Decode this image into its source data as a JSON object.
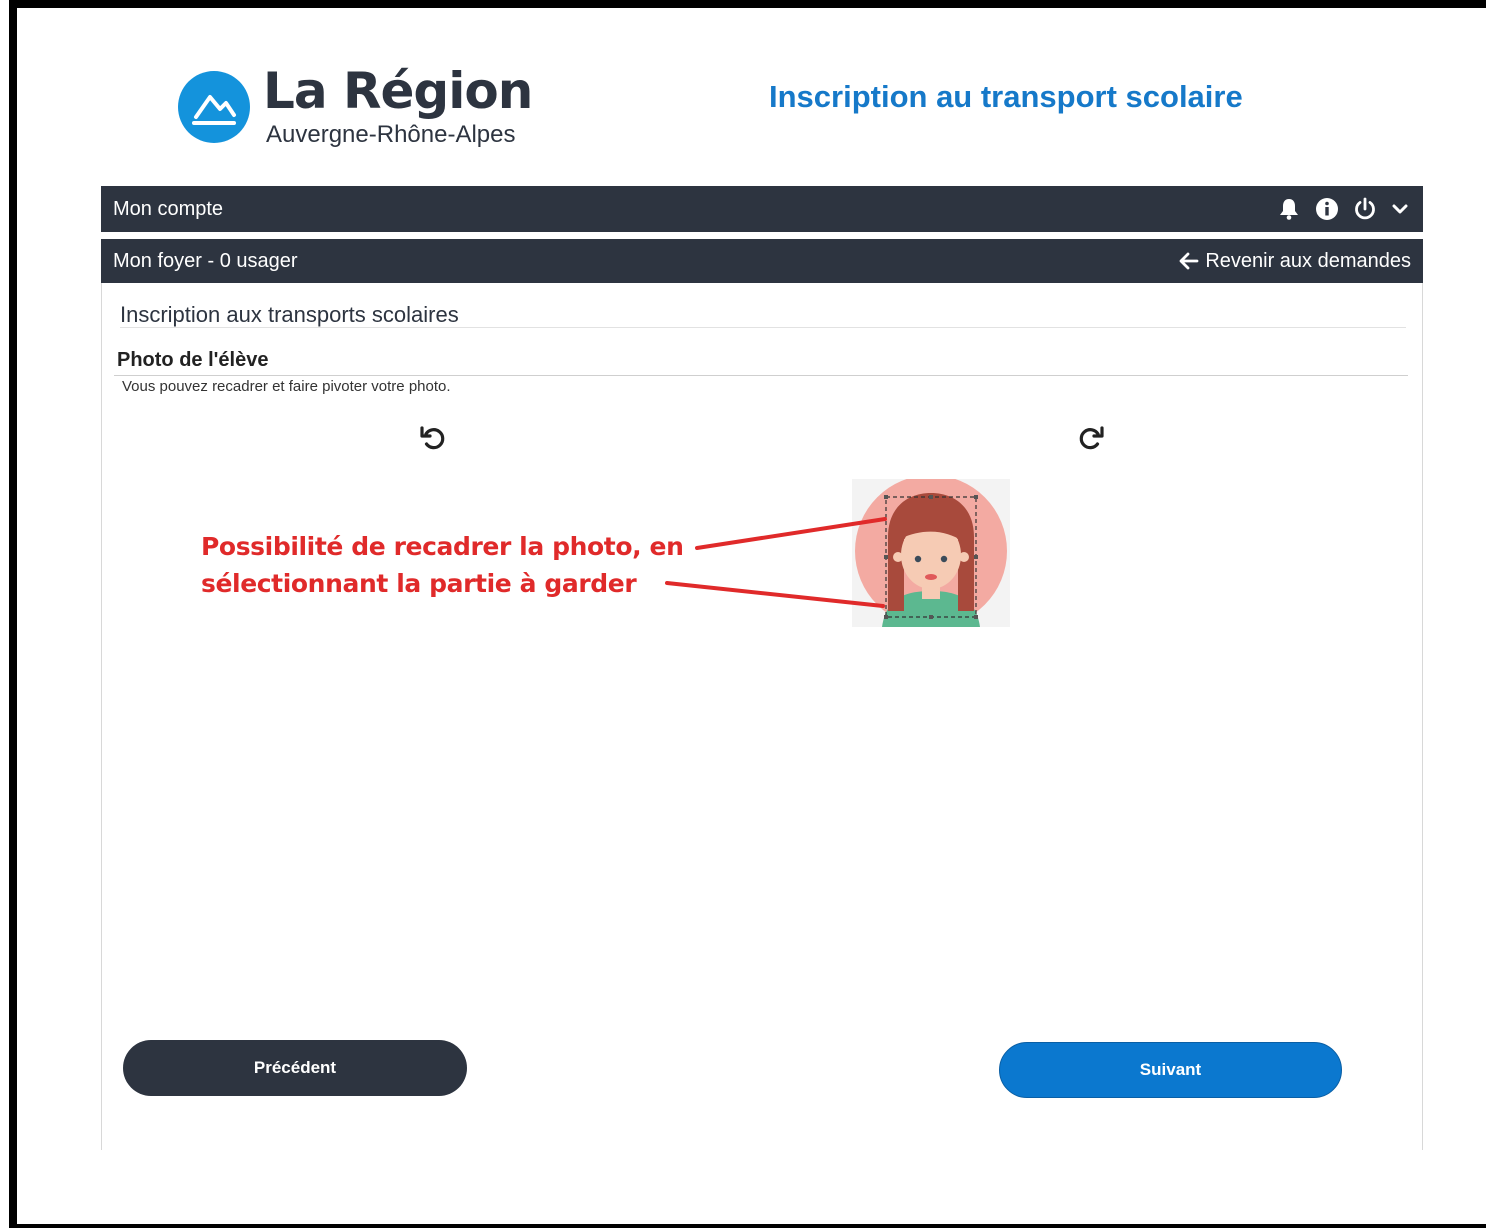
{
  "header": {
    "logo_title": "La Région",
    "logo_subtitle": "Auvergne-Rhône-Alpes",
    "app_title": "Inscription au transport scolaire"
  },
  "account_bar": {
    "label": "Mon compte",
    "icons": [
      "bell-icon",
      "info-icon",
      "power-icon",
      "chevron-down-icon"
    ]
  },
  "household_bar": {
    "label": "Mon foyer - 0 usager",
    "back_link": "Revenir aux demandes"
  },
  "main": {
    "section_title": "Inscription aux transports scolaires",
    "photo_title": "Photo de l'élève",
    "photo_hint": "Vous pouvez recadrer et faire pivoter votre photo."
  },
  "annotation": {
    "line1": "Possibilité de recadrer la photo, en",
    "line2": "sélectionnant la partie à garder",
    "color": "#e02a2a"
  },
  "footer": {
    "prev_label": "Précédent",
    "next_label": "Suivant"
  },
  "colors": {
    "brand_blue": "#1493dc",
    "bar_dark": "#2d3440",
    "primary_button": "#0b78cf"
  }
}
